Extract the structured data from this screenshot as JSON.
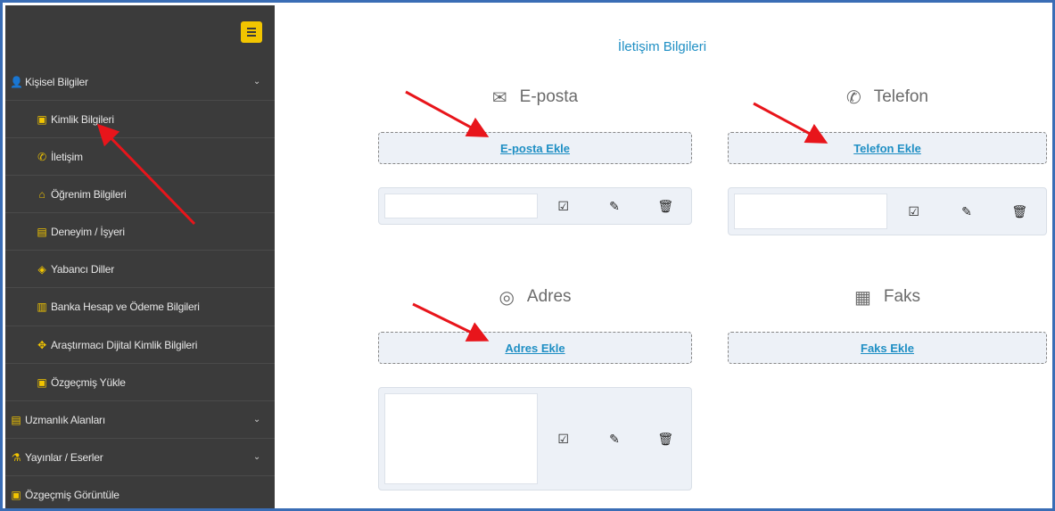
{
  "sidebar": {
    "items": [
      {
        "label": "Kişisel Bilgiler",
        "icon": "user-icon",
        "glyph": "👤",
        "level": "top",
        "expandable": true
      },
      {
        "label": "Kimlik Bilgileri",
        "icon": "id-card-icon",
        "glyph": "🪪",
        "level": "sub"
      },
      {
        "label": "İletişim",
        "icon": "phone-icon",
        "glyph": "✆",
        "level": "sub"
      },
      {
        "label": "Öğrenim Bilgileri",
        "icon": "graduation-cap-icon",
        "glyph": "🎓",
        "level": "sub"
      },
      {
        "label": "Deneyim / İşyeri",
        "icon": "briefcase-icon",
        "glyph": "💼",
        "level": "sub"
      },
      {
        "label": "Yabancı Diller",
        "icon": "language-icon",
        "glyph": "🈂",
        "level": "sub"
      },
      {
        "label": "Banka Hesap ve Ödeme Bilgileri",
        "icon": "bank-icon",
        "glyph": "🏛",
        "level": "sub"
      },
      {
        "label": "Araştırmacı Dijital Kimlik Bilgileri",
        "icon": "network-icon",
        "glyph": "✥",
        "level": "sub"
      },
      {
        "label": "Özgeçmiş Yükle",
        "icon": "id-card-icon",
        "glyph": "🪪",
        "level": "sub"
      },
      {
        "label": "Uzmanlık Alanları",
        "icon": "briefcase-icon",
        "glyph": "💼",
        "level": "top",
        "expandable": true
      },
      {
        "label": "Yayınlar / Eserler",
        "icon": "flask-icon",
        "glyph": "⚗",
        "level": "top",
        "expandable": true
      },
      {
        "label": "Özgeçmiş Görüntüle",
        "icon": "id-card-icon",
        "glyph": "🪪",
        "level": "top",
        "expandable": false
      }
    ]
  },
  "main": {
    "title": "İletişim Bilgileri",
    "sections": {
      "email": {
        "title": "E-posta",
        "icon": "envelope-icon",
        "glyph": "✉",
        "add_label": "E-posta Ekle"
      },
      "phone": {
        "title": "Telefon",
        "icon": "phone-icon",
        "glyph": "✆",
        "add_label": "Telefon Ekle"
      },
      "address": {
        "title": "Adres",
        "icon": "map-pin-icon",
        "glyph": "◎",
        "add_label": "Adres Ekle"
      },
      "fax": {
        "title": "Faks",
        "icon": "fax-icon",
        "glyph": "📠",
        "add_label": "Faks Ekle"
      }
    },
    "actions": {
      "check": "☑",
      "edit": "✎",
      "delete": "🗑"
    }
  },
  "colors": {
    "sidebar_bg": "#3b3b3b",
    "accent_yellow": "#f2c500",
    "link_blue": "#1f8fc4",
    "card_bg": "#edf1f7",
    "frame_border": "#3a6db5",
    "annotation_arrow": "#e8151b"
  }
}
